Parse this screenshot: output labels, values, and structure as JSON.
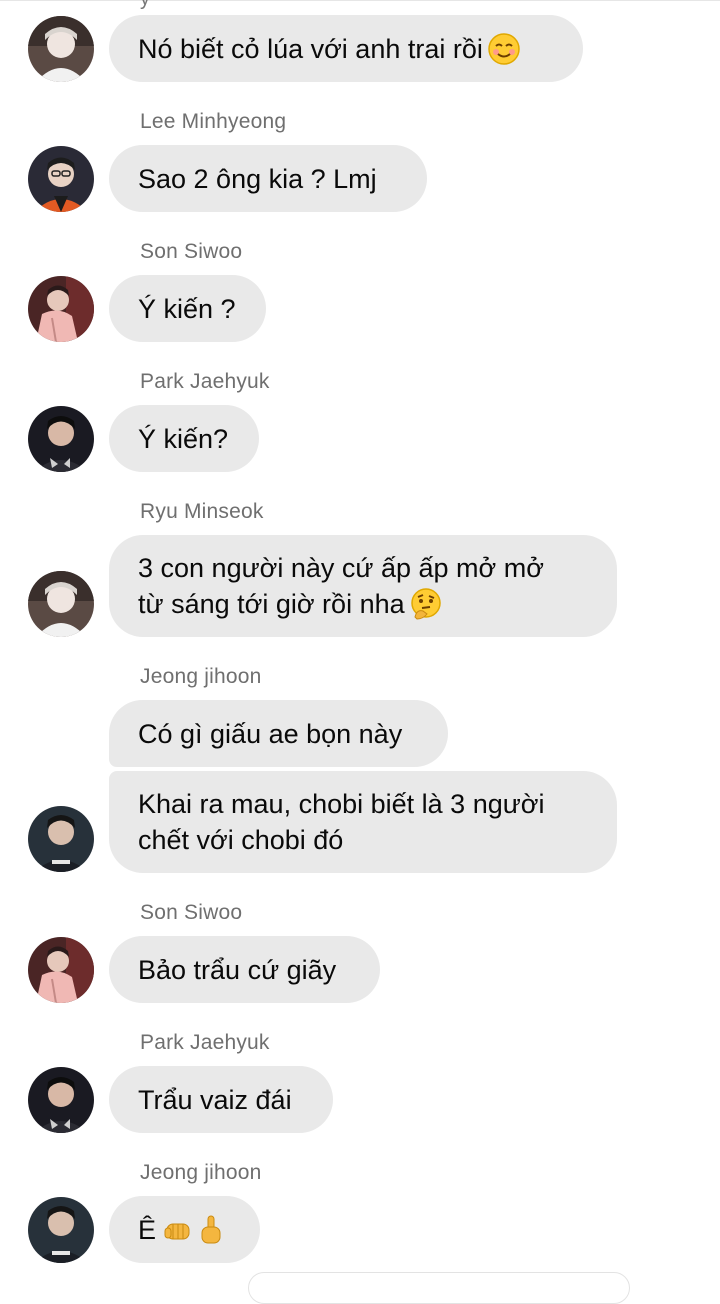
{
  "top_cut_name": "y",
  "messages": [
    {
      "sender": "",
      "avatar": "avatar-light-hair",
      "text": "Nó biết cỏ lúa với anh trai rồi",
      "emoji": "smiling-face-icon"
    },
    {
      "sender": "Lee Minhyeong",
      "avatar": "avatar-orange-jersey",
      "text": "Sao 2 ông kia ? Lmj"
    },
    {
      "sender": "Son Siwoo",
      "avatar": "avatar-pink-jacket",
      "text": "Ý kiến ?"
    },
    {
      "sender": "Park Jaehyuk",
      "avatar": "avatar-dark-jersey",
      "text": "Ý kiến?"
    },
    {
      "sender": "Ryu Minseok",
      "avatar": "avatar-light-hair",
      "text_lines": [
        "3 con người này cứ ấp ấp mở mở",
        "từ sáng tới giờ rồi nha"
      ],
      "emoji": "thinking-face-icon"
    },
    {
      "sender": "Jeong jihoon",
      "avatar": "avatar-team-jersey",
      "texts": [
        "Có gì giấu ae bọn này",
        "Khai ra mau, chobi biết là 3 người",
        "chết với chobi đó"
      ]
    },
    {
      "sender": "Son Siwoo",
      "avatar": "avatar-pink-jacket",
      "text": "Bảo trẩu cứ giãy"
    },
    {
      "sender": "Park Jaehyuk",
      "avatar": "avatar-dark-jersey",
      "text": "Trẩu vaiz đái"
    },
    {
      "sender": "Jeong jihoon",
      "avatar": "avatar-team-jersey",
      "text": "Ê",
      "emojis": [
        "fist-icon",
        "middle-finger-icon"
      ]
    }
  ]
}
